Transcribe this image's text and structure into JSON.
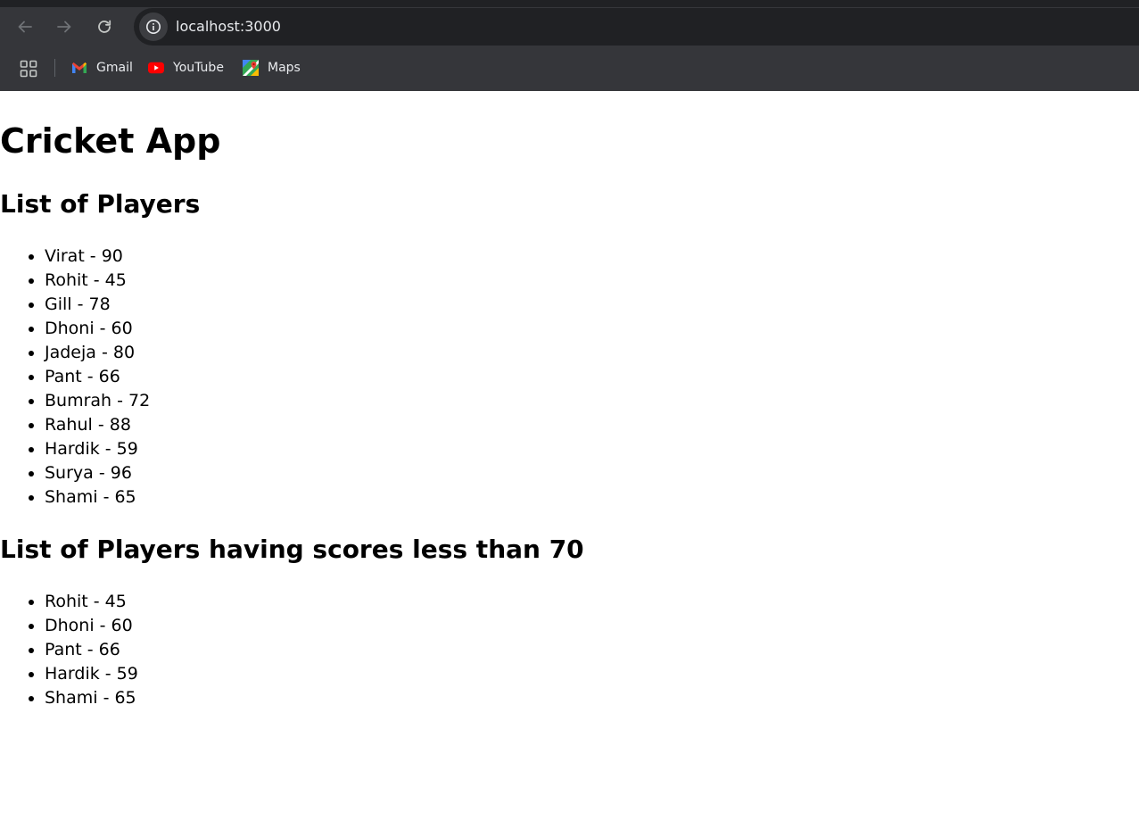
{
  "browser": {
    "url": "localhost:3000",
    "bookmarks": [
      {
        "label": "Gmail",
        "icon": "gmail-icon"
      },
      {
        "label": "YouTube",
        "icon": "youtube-icon"
      },
      {
        "label": "Maps",
        "icon": "maps-icon"
      }
    ]
  },
  "page": {
    "title": "Cricket App",
    "all_players_heading": "List of Players",
    "all_players": [
      "Virat - 90",
      "Rohit - 45",
      "Gill - 78",
      "Dhoni - 60",
      "Jadeja - 80",
      "Pant - 66",
      "Bumrah - 72",
      "Rahul - 88",
      "Hardik - 59",
      "Surya - 96",
      "Shami - 65"
    ],
    "filtered_heading": "List of Players having scores less than 70",
    "filtered_players": [
      "Rohit - 45",
      "Dhoni - 60",
      "Pant - 66",
      "Hardik - 59",
      "Shami - 65"
    ]
  }
}
